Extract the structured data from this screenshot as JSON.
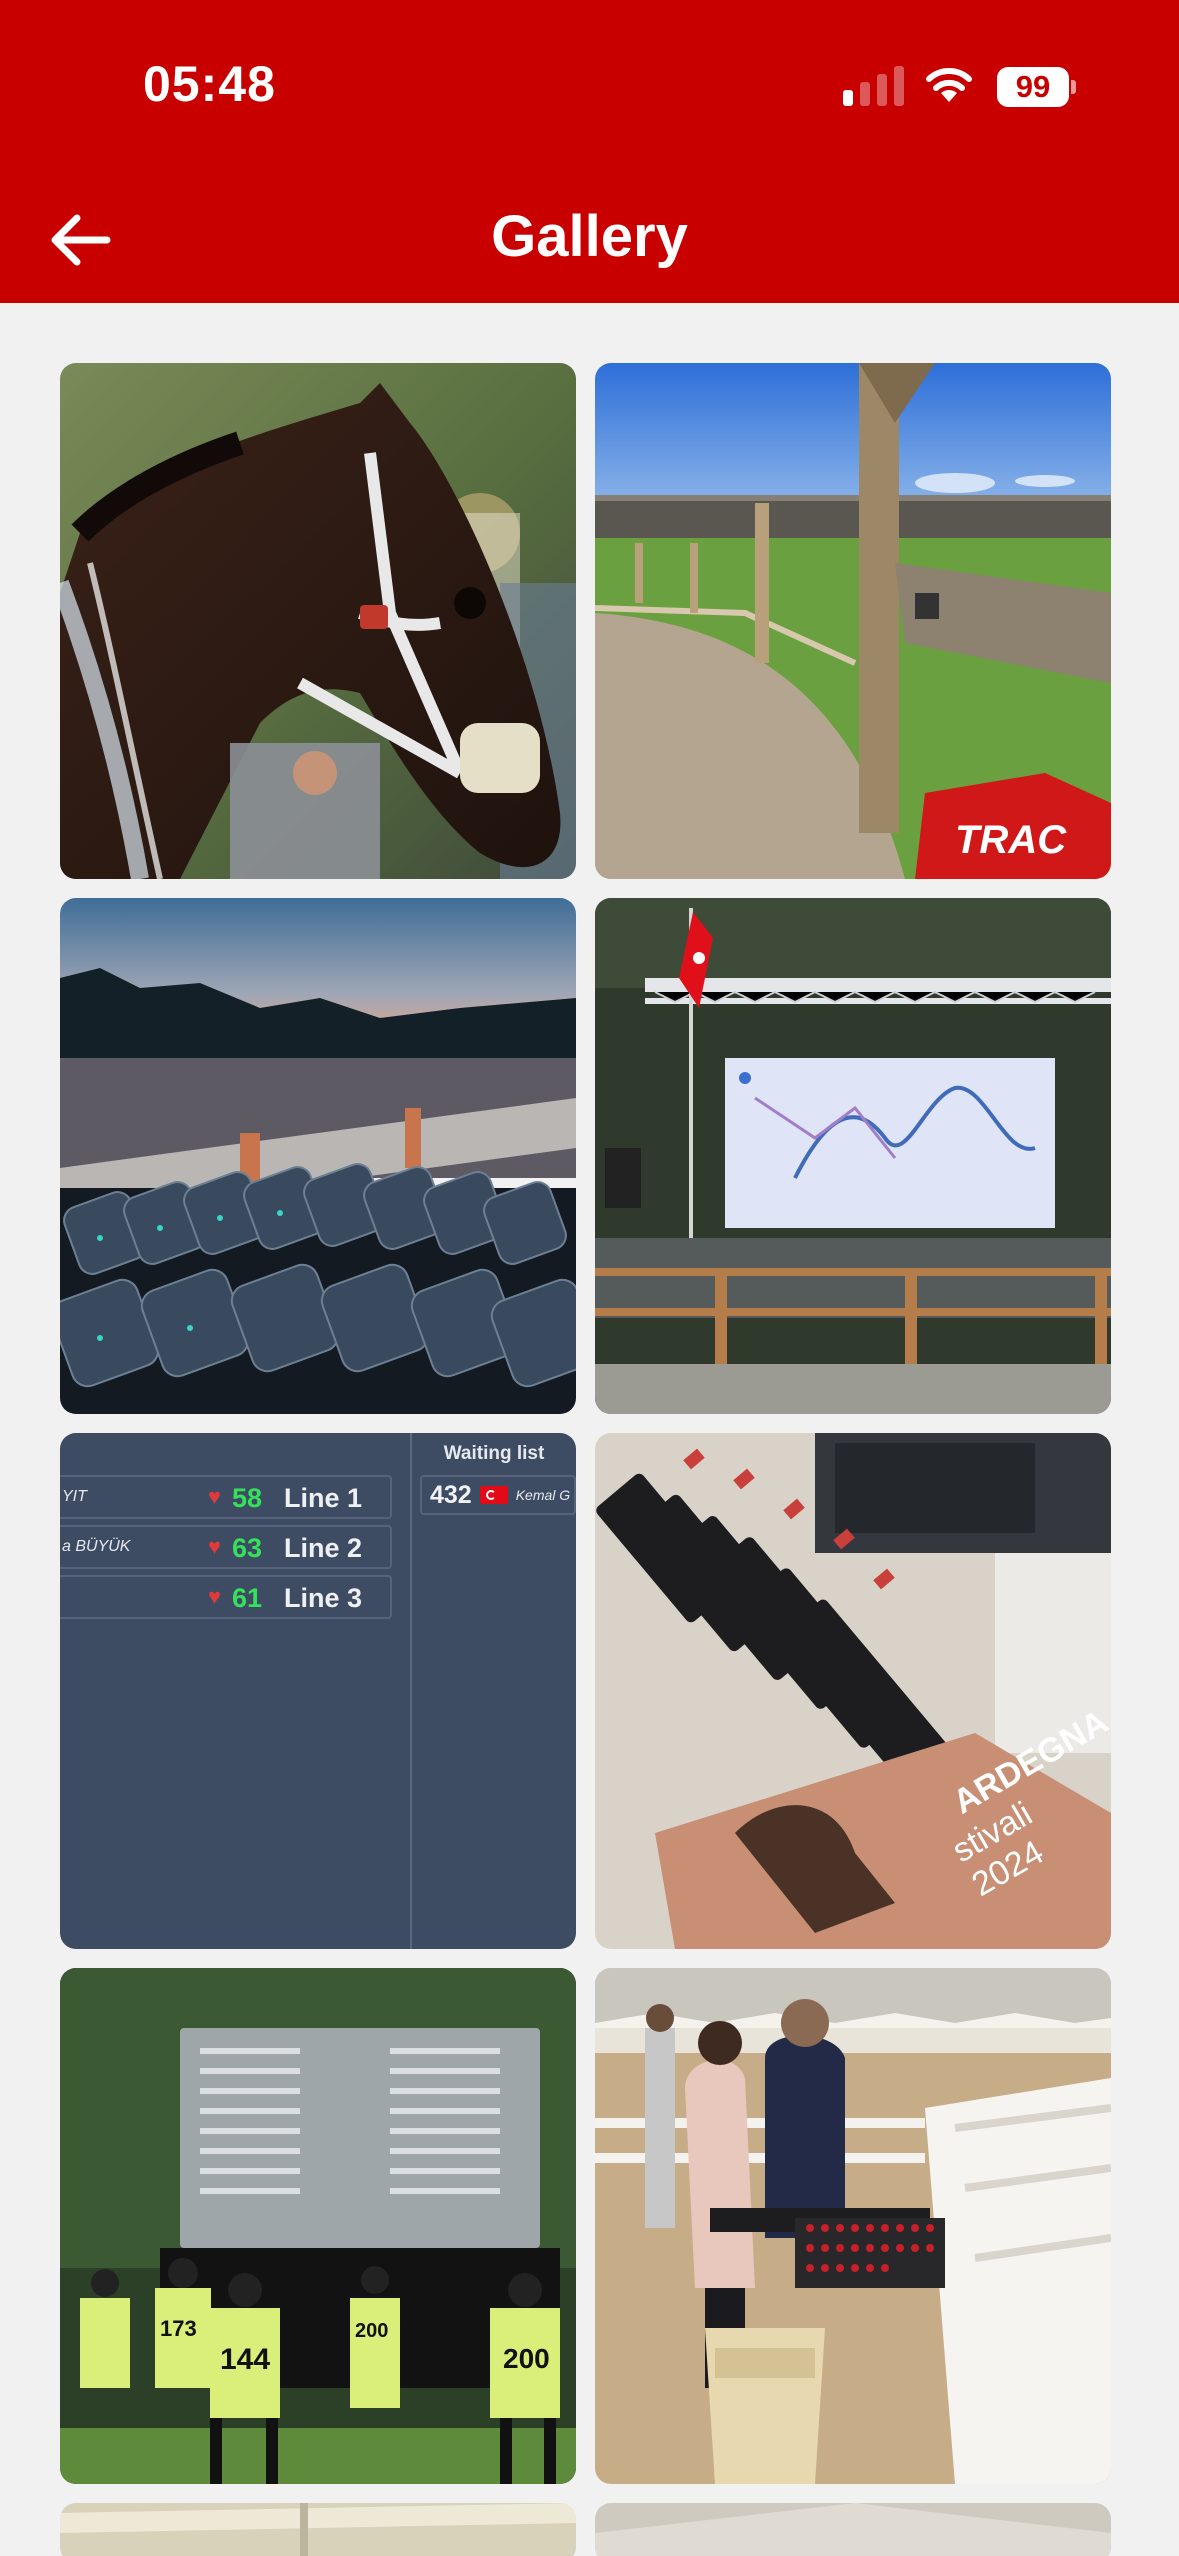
{
  "status_bar": {
    "time": "05:48",
    "battery": "99"
  },
  "header": {
    "title": "Gallery",
    "back_icon": "arrow-left-icon"
  },
  "scoreboard": {
    "waiting_label": "Waiting list",
    "rows": [
      {
        "name": "YIT",
        "value": "58",
        "line": "Line 1"
      },
      {
        "name": "a BÜYÜK",
        "value": "63",
        "line": "Line 2"
      },
      {
        "name": "",
        "value": "61",
        "line": "Line 3"
      }
    ],
    "waiting_entry": {
      "number": "432",
      "name": "Kemal G"
    }
  },
  "photos": {
    "horse_label": "",
    "booklet_text_1": "ARDEGNA",
    "booklet_text_2": "stivali 2024",
    "case_text": "TRAC",
    "bibs": [
      "173",
      "144",
      "200",
      "200"
    ]
  },
  "colors": {
    "brand_red": "#c90000",
    "background": "#f1f1f2"
  }
}
